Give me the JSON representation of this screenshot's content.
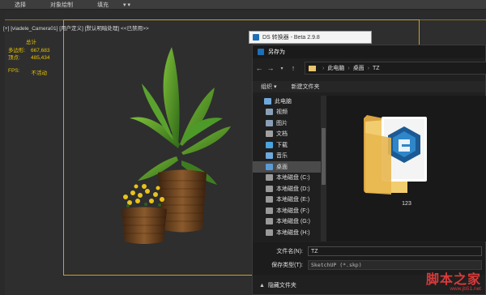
{
  "menubar": {
    "items": [
      "选择",
      "对象绘制",
      "填充",
      "▾ ▾"
    ]
  },
  "viewport": {
    "label": "[+] [viadele_Camera01] [用户定义] [默认明暗处理] <<已禁用>>",
    "stats": {
      "title": "总计",
      "polys_label": "多边形:",
      "polys_value": "667,683",
      "verts_label": "顶点:",
      "verts_value": "485,434"
    },
    "fps_label": "FPS:",
    "fps_value": "不活动"
  },
  "ds_window": {
    "title": "DS 转换器 - Beta 2.9.8"
  },
  "dialog": {
    "title": "另存为",
    "path": [
      "此电脑",
      "桌面",
      "TZ"
    ],
    "toolbar": {
      "organize": "组织 ▾",
      "new_folder": "新建文件夹"
    },
    "sidebar": [
      {
        "label": "此电脑",
        "icon": "computer-icon",
        "color": "#6fa8dc"
      },
      {
        "label": "视频",
        "icon": "video-icon",
        "color": "#8aa0b8"
      },
      {
        "label": "图片",
        "icon": "picture-icon",
        "color": "#8aa0b8"
      },
      {
        "label": "文档",
        "icon": "document-icon",
        "color": "#a0a0a0"
      },
      {
        "label": "下载",
        "icon": "download-icon",
        "color": "#4aa3df"
      },
      {
        "label": "音乐",
        "icon": "music-icon",
        "color": "#6fa8dc"
      },
      {
        "label": "桌面",
        "icon": "desktop-icon",
        "color": "#5b9bd5"
      },
      {
        "label": "本地磁盘 (C:)",
        "icon": "disk-icon",
        "color": "#9a9a9a"
      },
      {
        "label": "本地磁盘 (D:)",
        "icon": "disk-icon",
        "color": "#9a9a9a"
      },
      {
        "label": "本地磁盘 (E:)",
        "icon": "disk-icon",
        "color": "#9a9a9a"
      },
      {
        "label": "本地磁盘 (F:)",
        "icon": "disk-icon",
        "color": "#9a9a9a"
      },
      {
        "label": "本地磁盘 (G:)",
        "icon": "disk-icon",
        "color": "#9a9a9a"
      },
      {
        "label": "本地磁盘 (H:)",
        "icon": "disk-icon",
        "color": "#9a9a9a"
      }
    ],
    "selected_sidebar": "桌面",
    "file_item": {
      "label": "123"
    },
    "filename_label": "文件名(N):",
    "filename_value": "TZ",
    "filetype_label": "保存类型(T):",
    "filetype_value": "SketchUP (*.skp)",
    "hide_folders": "隐藏文件夹"
  },
  "watermark": {
    "text": "脚本之家",
    "url": "www.jb51.net"
  }
}
